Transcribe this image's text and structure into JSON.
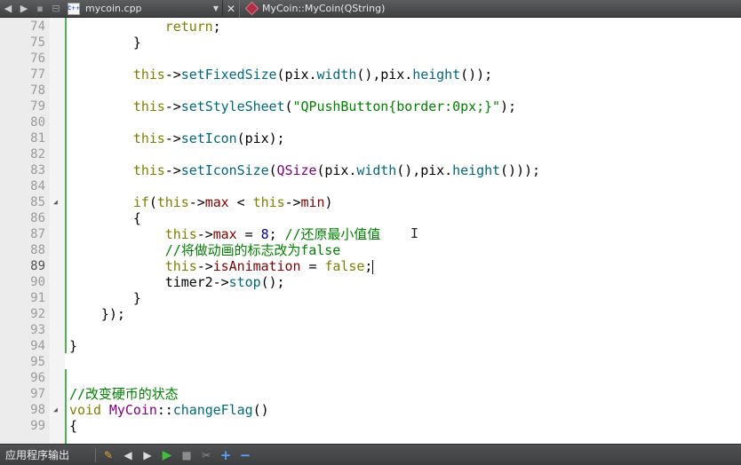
{
  "tabbar": {
    "file_name": "mycoin.cpp",
    "file_icon_text": "C++",
    "function_name": "MyCoin::MyCoin(QString)",
    "close_glyph": "✕"
  },
  "editor": {
    "current_line": 89,
    "lines": [
      {
        "n": "74",
        "tokens": [
          {
            "t": "            "
          },
          {
            "t": "return",
            "c": "kw"
          },
          {
            "t": ";"
          }
        ]
      },
      {
        "n": "75",
        "tokens": [
          {
            "t": "        }"
          }
        ]
      },
      {
        "n": "76",
        "tokens": []
      },
      {
        "n": "77",
        "tokens": [
          {
            "t": "        "
          },
          {
            "t": "this",
            "c": "kw"
          },
          {
            "t": "->"
          },
          {
            "t": "setFixedSize",
            "c": "fn"
          },
          {
            "t": "(pix."
          },
          {
            "t": "width",
            "c": "fn"
          },
          {
            "t": "(),pix."
          },
          {
            "t": "height",
            "c": "fn"
          },
          {
            "t": "());"
          }
        ]
      },
      {
        "n": "78",
        "tokens": []
      },
      {
        "n": "79",
        "tokens": [
          {
            "t": "        "
          },
          {
            "t": "this",
            "c": "kw"
          },
          {
            "t": "->"
          },
          {
            "t": "setStyleSheet",
            "c": "fn"
          },
          {
            "t": "("
          },
          {
            "t": "\"QPushButton{border:0px;}\"",
            "c": "str"
          },
          {
            "t": ");"
          }
        ]
      },
      {
        "n": "80",
        "tokens": []
      },
      {
        "n": "81",
        "tokens": [
          {
            "t": "        "
          },
          {
            "t": "this",
            "c": "kw"
          },
          {
            "t": "->"
          },
          {
            "t": "setIcon",
            "c": "fn"
          },
          {
            "t": "(pix);"
          }
        ]
      },
      {
        "n": "82",
        "tokens": []
      },
      {
        "n": "83",
        "tokens": [
          {
            "t": "        "
          },
          {
            "t": "this",
            "c": "kw"
          },
          {
            "t": "->"
          },
          {
            "t": "setIconSize",
            "c": "fn"
          },
          {
            "t": "("
          },
          {
            "t": "QSize",
            "c": "cls"
          },
          {
            "t": "(pix."
          },
          {
            "t": "width",
            "c": "fn"
          },
          {
            "t": "(),pix."
          },
          {
            "t": "height",
            "c": "fn"
          },
          {
            "t": "()));"
          }
        ]
      },
      {
        "n": "84",
        "tokens": []
      },
      {
        "n": "85",
        "fold": true,
        "tokens": [
          {
            "t": "        "
          },
          {
            "t": "if",
            "c": "kw"
          },
          {
            "t": "("
          },
          {
            "t": "this",
            "c": "kw"
          },
          {
            "t": "->"
          },
          {
            "t": "max",
            "c": "mem"
          },
          {
            "t": " < "
          },
          {
            "t": "this",
            "c": "kw"
          },
          {
            "t": "->"
          },
          {
            "t": "min",
            "c": "mem"
          },
          {
            "t": ")"
          }
        ]
      },
      {
        "n": "86",
        "tokens": [
          {
            "t": "        {"
          }
        ]
      },
      {
        "n": "87",
        "tokens": [
          {
            "t": "            "
          },
          {
            "t": "this",
            "c": "kw"
          },
          {
            "t": "->"
          },
          {
            "t": "max",
            "c": "mem"
          },
          {
            "t": " = "
          },
          {
            "t": "8",
            "c": "num"
          },
          {
            "t": "; "
          },
          {
            "t": "//还原最小值值",
            "c": "cmt"
          }
        ]
      },
      {
        "n": "88",
        "tokens": [
          {
            "t": "            "
          },
          {
            "t": "//将做动画的标志改为false",
            "c": "cmt"
          }
        ]
      },
      {
        "n": "89",
        "tokens": [
          {
            "t": "            "
          },
          {
            "t": "this",
            "c": "kw"
          },
          {
            "t": "->"
          },
          {
            "t": "isAnimation",
            "c": "mem"
          },
          {
            "t": " = "
          },
          {
            "t": "false",
            "c": "kw"
          },
          {
            "t": ";"
          }
        ],
        "cursor": true
      },
      {
        "n": "90",
        "tokens": [
          {
            "t": "            timer2->"
          },
          {
            "t": "stop",
            "c": "fn"
          },
          {
            "t": "();"
          }
        ]
      },
      {
        "n": "91",
        "tokens": [
          {
            "t": "        }"
          }
        ]
      },
      {
        "n": "92",
        "tokens": [
          {
            "t": "    });"
          }
        ]
      },
      {
        "n": "93",
        "tokens": []
      },
      {
        "n": "94",
        "tokens": [
          {
            "t": "}"
          }
        ]
      },
      {
        "n": "95",
        "tokens": []
      },
      {
        "n": "96",
        "tokens": []
      },
      {
        "n": "97",
        "tokens": [
          {
            "t": "//改变硬币的状态",
            "c": "cmt"
          }
        ]
      },
      {
        "n": "98",
        "fold": true,
        "tokens": [
          {
            "t": "void",
            "c": "kw"
          },
          {
            "t": " "
          },
          {
            "t": "MyCoin",
            "c": "cls"
          },
          {
            "t": "::"
          },
          {
            "t": "changeFlag",
            "c": "fn"
          },
          {
            "t": "()"
          }
        ]
      },
      {
        "n": "99",
        "tokens": [
          {
            "t": "{"
          }
        ]
      }
    ]
  },
  "statusbar": {
    "output_label": "应用程序输出"
  },
  "icons": {
    "back": "back-arrow-icon",
    "forward": "forward-arrow-icon",
    "lock": "lock-icon",
    "split": "split-icon",
    "file": "cpp-file-icon",
    "function": "function-symbol-icon",
    "close": "close-icon"
  },
  "colors": {
    "keyword": "#808000",
    "string_comment": "#008000",
    "function": "#00677c",
    "member": "#800000",
    "class": "#800080",
    "number": "#000080",
    "gutter": "#ececec",
    "change_bar": "#4caf50"
  }
}
